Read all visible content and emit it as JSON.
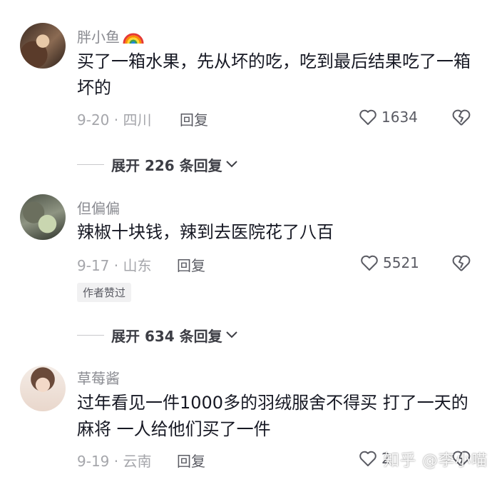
{
  "comments": [
    {
      "username": "胖小鱼",
      "text": "买了一箱水果，先从坏的吃，吃到最后结果吃了一箱坏的",
      "meta": "9-20 · 四川",
      "reply": "回复",
      "likes": "1634",
      "expand": "展开 226 条回复"
    },
    {
      "username": "但偏偏",
      "text": "辣椒十块钱，辣到去医院花了八百",
      "meta": "9-17 · 山东",
      "reply": "回复",
      "likes": "5521",
      "badge": "作者赞过",
      "expand": "展开 634 条回复"
    },
    {
      "username": "草莓酱",
      "text": "过年看见一件1000多的羽绒服舍不得买 打了一天的麻将 一人给他们买了一件",
      "meta": "9-19 · 云南",
      "reply": "回复",
      "likes": "2"
    }
  ],
  "watermark": "知乎 @李小喵"
}
